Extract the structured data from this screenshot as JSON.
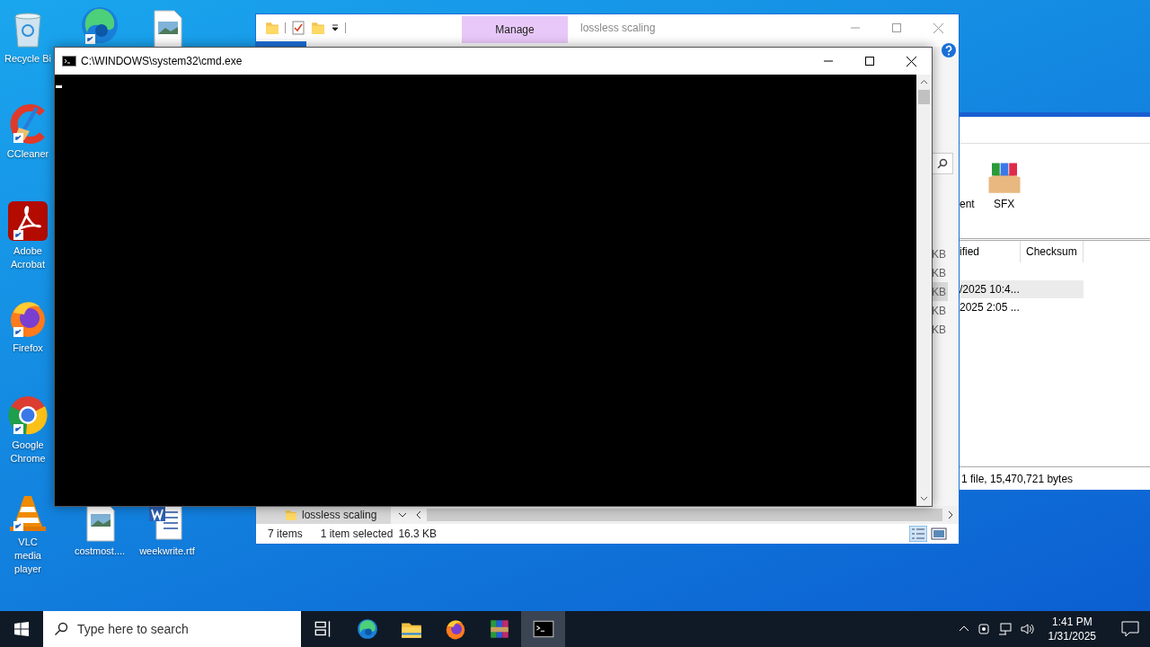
{
  "desktop_icons": [
    {
      "kind": "recycle",
      "label": "Recycle Bi"
    },
    {
      "kind": "edge"
    },
    {
      "kind": "image"
    },
    {
      "kind": "ccleaner",
      "label": "CCleaner"
    },
    {
      "kind": "acrobat",
      "label": "Adobe Acrobat"
    },
    {
      "kind": "firefox",
      "label": "Firefox"
    },
    {
      "kind": "chrome",
      "label": "Google Chrome"
    },
    {
      "kind": "vlc",
      "label": "VLC media player"
    },
    {
      "kind": "image",
      "label": "costmost...."
    },
    {
      "kind": "word",
      "label": "weekwrite.rtf"
    }
  ],
  "winrar": {
    "toolbar": [
      {
        "kind": "partial",
        "label": "ent"
      },
      {
        "kind": "sfx",
        "label": "SFX"
      }
    ],
    "columns": [
      "ified",
      "Checksum"
    ],
    "rows": [
      {
        "modified": "/2025 10:4...",
        "selected": true
      },
      {
        "modified": "2025 2:05 ...",
        "selected": false
      }
    ],
    "status": "1 file, 15,470,721 bytes"
  },
  "explorer": {
    "ribbon_tab": "Manage",
    "title": "lossless scaling",
    "sizes": [
      {
        "text": "KB",
        "selected": false
      },
      {
        "text": "KB",
        "selected": false
      },
      {
        "text": "KB",
        "selected": true
      },
      {
        "text": "KB",
        "selected": false
      },
      {
        "text": "KB",
        "selected": false
      }
    ],
    "nav_item": "lossless scaling",
    "status": {
      "count": "7 items",
      "selection": "1 item selected",
      "size": "16.3 KB"
    }
  },
  "cmd": {
    "title": "C:\\WINDOWS\\system32\\cmd.exe"
  },
  "taskbar": {
    "search_placeholder": "Type here to search",
    "apps": [
      {
        "kind": "taskview",
        "selected": false
      },
      {
        "kind": "edge",
        "selected": false
      },
      {
        "kind": "explorer",
        "selected": false
      },
      {
        "kind": "firefox",
        "selected": false
      },
      {
        "kind": "winrar",
        "selected": false
      },
      {
        "kind": "cmd",
        "selected": true
      }
    ],
    "time": "1:41 PM",
    "date": "1/31/2025"
  }
}
